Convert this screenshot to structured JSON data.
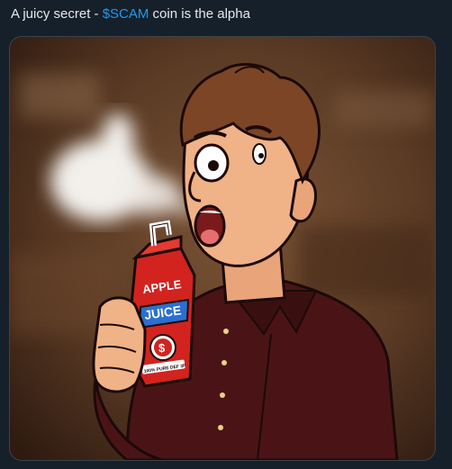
{
  "tweet": {
    "text_before": "A juicy secret - ",
    "cashtag": "$SCAM",
    "text_after": " coin is the alpha"
  },
  "media": {
    "alt": "Cartoon man vaping from an apple juice box",
    "carton": {
      "brand_top": "APPLE",
      "brand_bottom": "JUICE",
      "badge": "$",
      "footnote": "100% PURE DEF 3P"
    }
  },
  "colors": {
    "background": "#15202b",
    "text": "#e7e9ea",
    "link": "#1d9bf0",
    "border": "#38444d",
    "carton_red": "#d2231f"
  }
}
